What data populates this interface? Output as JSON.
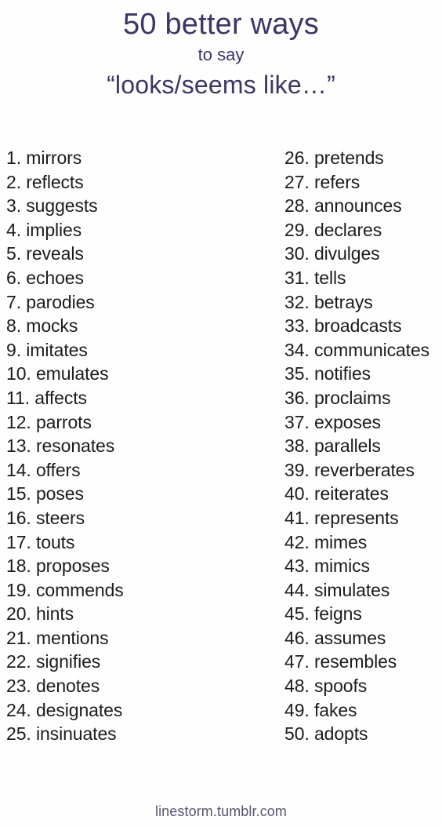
{
  "meta": {
    "background_color": "#fefefe",
    "title_color": "#3d3566",
    "list_text_color": "#1c1c1c",
    "footer_color": "#5b5370"
  },
  "title": {
    "line1": "50 better ways",
    "line2": "to say",
    "line3": "“looks/seems like…”"
  },
  "list": {
    "left_column": [
      {
        "number": "1.",
        "word": "mirrors"
      },
      {
        "number": "2.",
        "word": "reflects"
      },
      {
        "number": "3.",
        "word": "suggests"
      },
      {
        "number": "4.",
        "word": "implies"
      },
      {
        "number": "5.",
        "word": "reveals"
      },
      {
        "number": "6.",
        "word": "echoes"
      },
      {
        "number": "7.",
        "word": "parodies"
      },
      {
        "number": "8.",
        "word": "mocks"
      },
      {
        "number": "9.",
        "word": "imitates"
      },
      {
        "number": "10.",
        "word": "emulates"
      },
      {
        "number": "11.",
        "word": "affects"
      },
      {
        "number": "12.",
        "word": "parrots"
      },
      {
        "number": "13.",
        "word": "resonates"
      },
      {
        "number": "14.",
        "word": "offers"
      },
      {
        "number": "15.",
        "word": "poses"
      },
      {
        "number": "16.",
        "word": "steers"
      },
      {
        "number": "17.",
        "word": "touts"
      },
      {
        "number": "18.",
        "word": "proposes"
      },
      {
        "number": "19.",
        "word": "commends"
      },
      {
        "number": "20.",
        "word": "hints"
      },
      {
        "number": "21.",
        "word": "mentions"
      },
      {
        "number": "22.",
        "word": "signifies"
      },
      {
        "number": "23.",
        "word": "denotes"
      },
      {
        "number": "24.",
        "word": "designates"
      },
      {
        "number": "25.",
        "word": "insinuates"
      }
    ],
    "right_column": [
      {
        "number": "26.",
        "word": "pretends"
      },
      {
        "number": "27.",
        "word": "refers"
      },
      {
        "number": "28.",
        "word": "announces"
      },
      {
        "number": "29.",
        "word": "declares"
      },
      {
        "number": "30.",
        "word": "divulges"
      },
      {
        "number": "31.",
        "word": "tells"
      },
      {
        "number": "32.",
        "word": "betrays"
      },
      {
        "number": "33.",
        "word": "broadcasts"
      },
      {
        "number": "34.",
        "word": "communicates"
      },
      {
        "number": "35.",
        "word": "notifies"
      },
      {
        "number": "36.",
        "word": "proclaims"
      },
      {
        "number": "37.",
        "word": "exposes"
      },
      {
        "number": "38.",
        "word": "parallels"
      },
      {
        "number": "39.",
        "word": "reverberates"
      },
      {
        "number": "40.",
        "word": "reiterates"
      },
      {
        "number": "41.",
        "word": "represents"
      },
      {
        "number": "42.",
        "word": "mimes"
      },
      {
        "number": "43.",
        "word": "mimics"
      },
      {
        "number": "44.",
        "word": "simulates"
      },
      {
        "number": "45.",
        "word": "feigns"
      },
      {
        "number": "46.",
        "word": "assumes"
      },
      {
        "number": "47.",
        "word": "resembles"
      },
      {
        "number": "48.",
        "word": "spoofs"
      },
      {
        "number": "49.",
        "word": "fakes"
      },
      {
        "number": "50.",
        "word": "adopts"
      }
    ]
  },
  "footer": {
    "text": "linestorm.tumblr.com"
  }
}
